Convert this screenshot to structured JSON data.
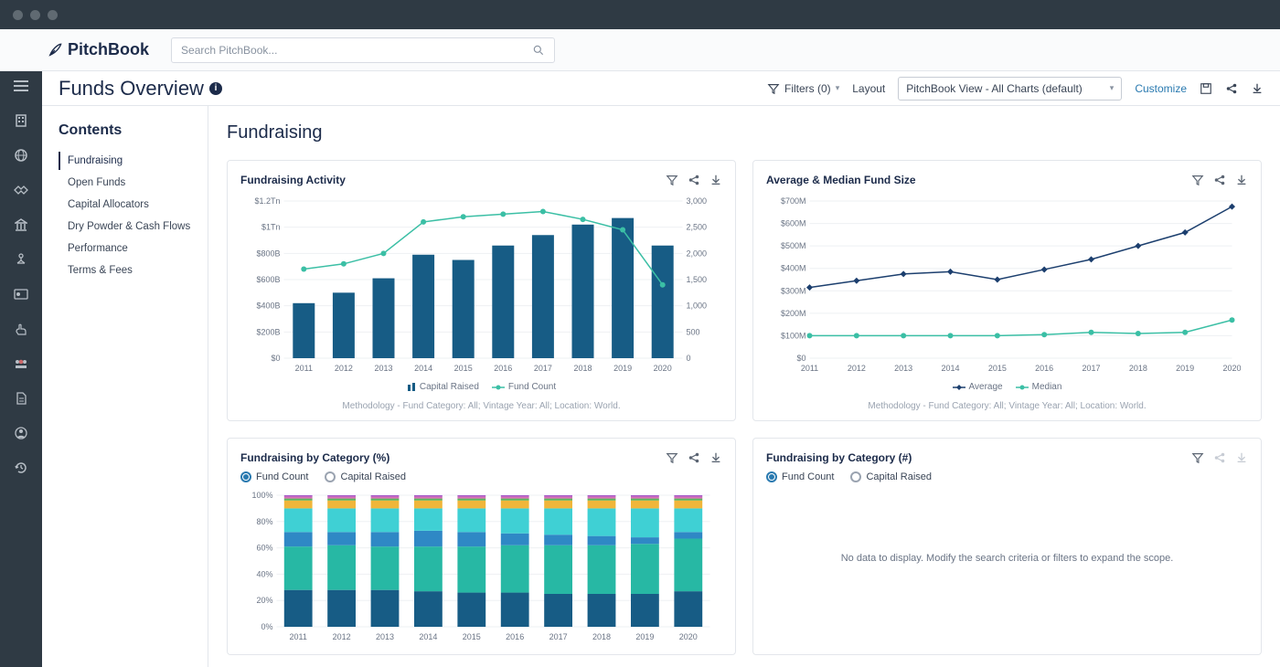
{
  "brand": "PitchBook",
  "search": {
    "placeholder": "Search PitchBook..."
  },
  "page": {
    "title": "Funds Overview"
  },
  "toolbar": {
    "filters_label": "Filters (0)",
    "layout_label": "Layout",
    "view_select": "PitchBook View - All Charts (default)",
    "customize": "Customize"
  },
  "toc": {
    "title": "Contents",
    "items": [
      "Fundraising",
      "Open Funds",
      "Capital Allocators",
      "Dry Powder & Cash Flows",
      "Performance",
      "Terms & Fees"
    ]
  },
  "section_title": "Fundraising",
  "cards": {
    "activity": {
      "title": "Fundraising Activity",
      "legend_bar": "Capital Raised",
      "legend_line": "Fund Count",
      "methodology": "Methodology - Fund Category: All; Vintage Year: All; Location: World."
    },
    "avg": {
      "title": "Average & Median Fund Size",
      "legend_a": "Average",
      "legend_b": "Median",
      "methodology": "Methodology - Fund Category: All; Vintage Year: All; Location: World."
    },
    "pct": {
      "title": "Fundraising by Category (%)",
      "radio_a": "Fund Count",
      "radio_b": "Capital Raised"
    },
    "num": {
      "title": "Fundraising by Category (#)",
      "radio_a": "Fund Count",
      "radio_b": "Capital Raised",
      "empty": "No data to display. Modify the search criteria or filters to expand the scope."
    }
  },
  "chart_data": [
    {
      "id": "fundraising_activity",
      "type": "bar+line",
      "categories": [
        "2011",
        "2012",
        "2013",
        "2014",
        "2015",
        "2016",
        "2017",
        "2018",
        "2019",
        "2020"
      ],
      "y_left_ticks": [
        "$0",
        "$200B",
        "$400B",
        "$600B",
        "$800B",
        "$1Tn",
        "$1.2Tn"
      ],
      "y_right_ticks": [
        "0",
        "500",
        "1,000",
        "1,500",
        "2,000",
        "2,500",
        "3,000"
      ],
      "bar_series": {
        "name": "Capital Raised",
        "values_b": [
          420,
          500,
          610,
          790,
          750,
          860,
          940,
          1020,
          1070,
          860
        ]
      },
      "line_series": {
        "name": "Fund Count",
        "values": [
          1700,
          1800,
          2000,
          2600,
          2700,
          2750,
          2800,
          2650,
          2450,
          1400
        ]
      }
    },
    {
      "id": "avg_median_fund_size",
      "type": "line",
      "categories": [
        "2011",
        "2012",
        "2013",
        "2014",
        "2015",
        "2016",
        "2017",
        "2018",
        "2019",
        "2020"
      ],
      "y_ticks": [
        "$0",
        "$100M",
        "$200M",
        "$300M",
        "$400M",
        "$500M",
        "$600M",
        "$700M"
      ],
      "series": [
        {
          "name": "Average",
          "values_m": [
            315,
            345,
            375,
            385,
            350,
            395,
            440,
            500,
            560,
            675
          ]
        },
        {
          "name": "Median",
          "values_m": [
            100,
            100,
            100,
            100,
            100,
            105,
            115,
            110,
            115,
            170
          ]
        }
      ]
    },
    {
      "id": "fundraising_by_category_pct",
      "type": "stacked_bar_pct",
      "categories": [
        "2011",
        "2012",
        "2013",
        "2014",
        "2015",
        "2016",
        "2017",
        "2018",
        "2019",
        "2020"
      ],
      "y_ticks": [
        "0%",
        "20%",
        "40%",
        "60%",
        "80%",
        "100%"
      ],
      "stack_colors": [
        "#175c85",
        "#27b8a4",
        "#2f88c5",
        "#3fd0d4",
        "#f0b63a",
        "#5ab45a",
        "#d46fb5",
        "#a858c9"
      ],
      "stacks": [
        [
          28,
          33,
          11,
          18,
          6,
          1.5,
          1.5,
          1
        ],
        [
          28,
          34,
          10,
          18,
          6,
          1.5,
          1.5,
          1
        ],
        [
          28,
          33,
          11,
          18,
          6,
          1.5,
          1.5,
          1
        ],
        [
          27,
          34,
          12,
          17,
          6,
          1.5,
          1.5,
          1
        ],
        [
          26,
          35,
          11,
          18,
          6,
          1.5,
          1.5,
          1
        ],
        [
          26,
          36,
          9,
          19,
          6,
          1.5,
          1.5,
          1
        ],
        [
          25,
          37,
          8,
          20,
          6,
          1.5,
          1.5,
          1
        ],
        [
          25,
          37,
          7,
          21,
          6,
          1.5,
          1.5,
          1
        ],
        [
          25,
          38,
          5,
          22,
          6,
          1.5,
          1.5,
          1
        ],
        [
          27,
          40,
          5,
          18,
          6,
          1.5,
          1.5,
          1
        ]
      ]
    },
    {
      "id": "fundraising_by_category_num",
      "type": "empty",
      "message": "No data to display. Modify the search criteria or filters to expand the scope."
    }
  ]
}
